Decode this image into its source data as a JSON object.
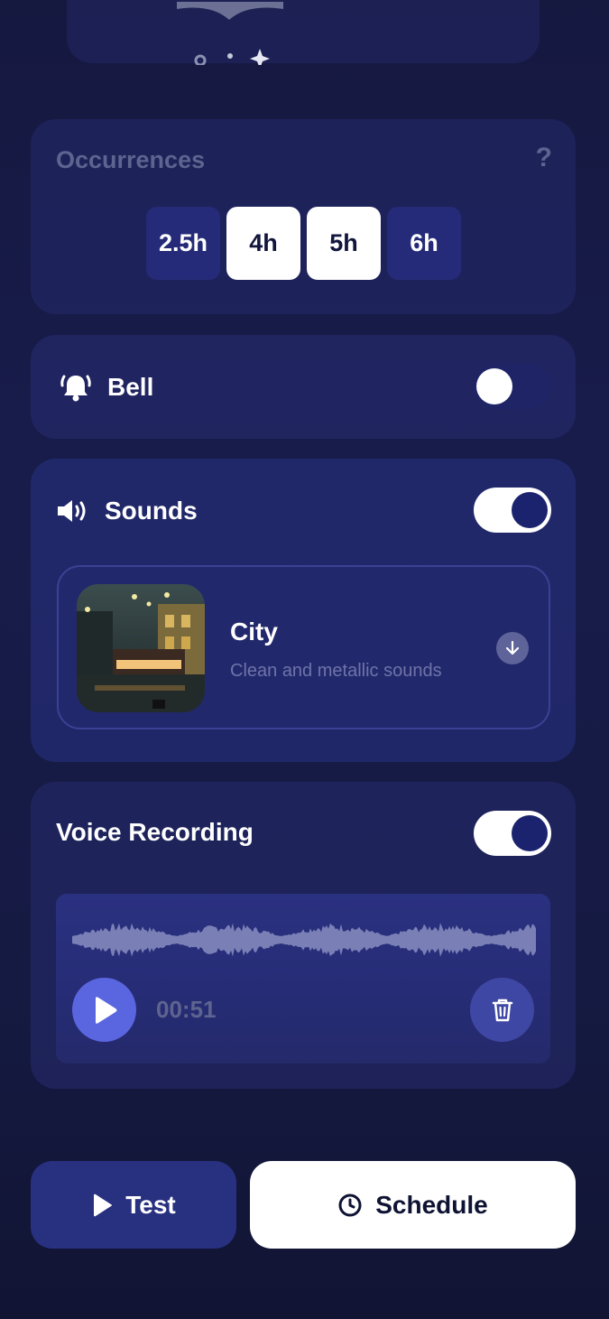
{
  "occurrences": {
    "title": "Occurrences",
    "help": "?",
    "options": [
      {
        "label": "2.5h",
        "selected": false
      },
      {
        "label": "4h",
        "selected": true
      },
      {
        "label": "5h",
        "selected": true
      },
      {
        "label": "6h",
        "selected": false
      }
    ]
  },
  "bell": {
    "label": "Bell",
    "icon": "bell-ring-icon",
    "enabled": false
  },
  "sounds": {
    "label": "Sounds",
    "icon": "speaker-icon",
    "enabled": true,
    "selected": {
      "title": "City",
      "subtitle": "Clean and metallic sounds",
      "action_icon": "download-arrow-icon"
    }
  },
  "voice_recording": {
    "label": "Voice Recording",
    "enabled": true,
    "duration": "00:51"
  },
  "actions": {
    "test_label": "Test",
    "schedule_label": "Schedule"
  },
  "colors": {
    "accent": "#5a66e0",
    "toggle_on_knob": "#1b236f",
    "background": "#15183f"
  }
}
